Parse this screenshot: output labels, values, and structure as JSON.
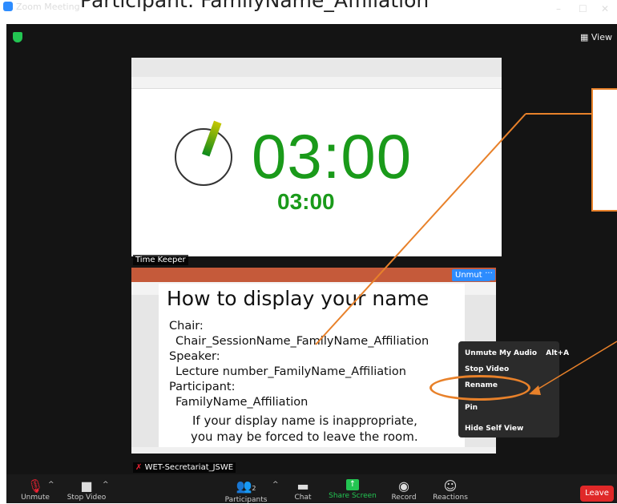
{
  "caption": "Participant:    FamilyName_Affiliation",
  "window": {
    "title": "Zoom Meeting",
    "min": "–",
    "max": "☐",
    "close": "✕",
    "view_label": "View"
  },
  "share_top": {
    "timer_big": "03:00",
    "timer_small": "03:00",
    "label": "Time Keeper"
  },
  "slide": {
    "title": "How to display your name",
    "lines": [
      "Chair:",
      "Chair_SessionName_FamilyName_Affiliation",
      "Speaker:",
      "Lecture number_FamilyName_Affiliation",
      "Participant:",
      "FamilyName_Affiliation",
      "If your display name is inappropriate,",
      "you may be forced to leave the room."
    ]
  },
  "video_chip": {
    "unmute": "Unmute",
    "more": "···"
  },
  "context_menu": {
    "unmute": "Unmute My Audio",
    "unmute_shortcut": "Alt+A",
    "stop_video": "Stop Video",
    "rename": "Rename",
    "pin": "Pin",
    "hide_self": "Hide Self View"
  },
  "self_name": "WET-Secretariat_JSWE",
  "toolbar": {
    "unmute": "Unmute",
    "stop_video": "Stop Video",
    "participants": "Participants",
    "participants_count": "2",
    "chat": "Chat",
    "share_screen": "Share Screen",
    "record": "Record",
    "reactions": "Reactions",
    "leave": "Leave"
  },
  "colors": {
    "accent_orange": "#e8812a",
    "zoom_blue": "#2d8cff",
    "timer_green": "#1a9a1a",
    "leave_red": "#e02828"
  }
}
